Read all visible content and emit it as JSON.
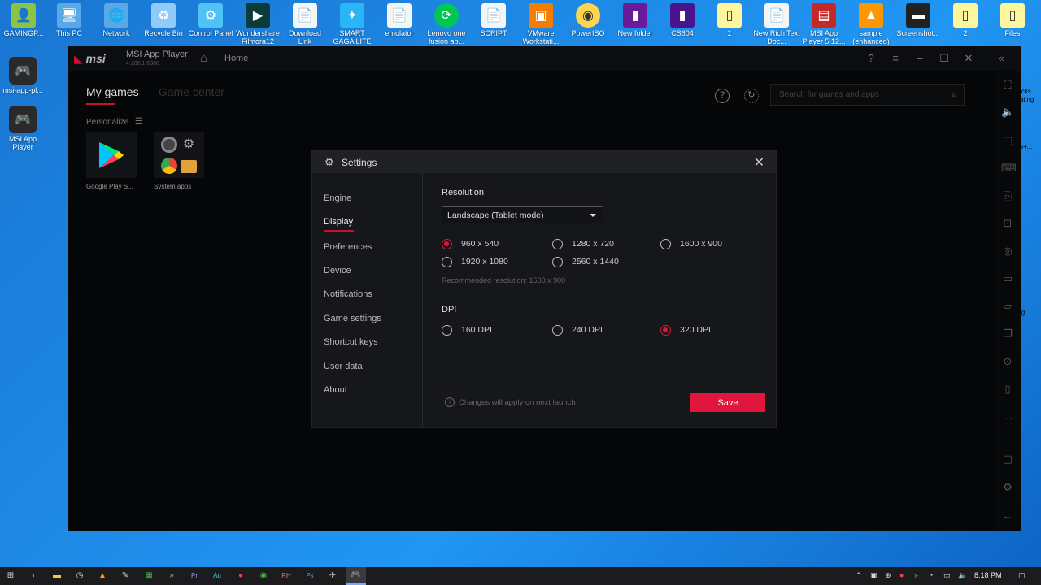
{
  "desktop": {
    "top_icons": [
      {
        "label": "GAMINGP...",
        "color": "#8bc34a"
      },
      {
        "label": "This PC",
        "color": "#5aa9e6"
      },
      {
        "label": "Network",
        "color": "#5aa9e6"
      },
      {
        "label": "Recycle Bin",
        "color": "#90caf9"
      },
      {
        "label": "Control Panel",
        "color": "#4fc3f7"
      },
      {
        "label": "Wondershare Filmora12",
        "color": "#0b3b3b"
      },
      {
        "label": "Download Link",
        "color": "#f5f5f5"
      },
      {
        "label": "SMART GAGA LITE",
        "color": "#29b6f6"
      },
      {
        "label": "emulator",
        "color": "#f5f5f5"
      },
      {
        "label": "Lenovo one fusion ap...",
        "color": "#00c853"
      },
      {
        "label": "SCRIPT",
        "color": "#f5f5f5"
      },
      {
        "label": "VMware Workstati...",
        "color": "#f57c00"
      },
      {
        "label": "PowerISO",
        "color": "#ffd54f"
      },
      {
        "label": "New folder",
        "color": "#6a1b9a"
      },
      {
        "label": "CS604",
        "color": "#4a148c"
      },
      {
        "label": "1",
        "color": "#fff59d"
      },
      {
        "label": "New Rich Text Doc...",
        "color": "#f5f5f5"
      },
      {
        "label": "MSI App Player 5.12...",
        "color": "#c62828"
      },
      {
        "label": "sample (enhanced)",
        "color": "#ff9800"
      },
      {
        "label": "Screenshot...",
        "color": "#212121"
      },
      {
        "label": "2",
        "color": "#fff59d"
      },
      {
        "label": "Files",
        "color": "#fff59d"
      }
    ],
    "left_icons": [
      {
        "label": "msi-app-pl..."
      },
      {
        "label": "MSI App Player"
      }
    ],
    "edge_labels": [
      "icks",
      "ating",
      "s+...",
      "lg"
    ]
  },
  "app": {
    "logo": "msi",
    "name": "MSI App Player",
    "version": "4.280.1.6308",
    "home_label": "Home",
    "tabs": {
      "active": "My games",
      "inactive": "Game center"
    },
    "search_placeholder": "Search for games and apps",
    "personalize": "Personalize",
    "apps": [
      {
        "label": "Google Play S..."
      },
      {
        "label": "System apps"
      }
    ]
  },
  "settings": {
    "title": "Settings",
    "nav": [
      "Engine",
      "Display",
      "Preferences",
      "Device",
      "Notifications",
      "Game settings",
      "Shortcut keys",
      "User data",
      "About"
    ],
    "active_nav": "Display",
    "resolution_title": "Resolution",
    "orientation_value": "Landscape (Tablet mode)",
    "resolutions": [
      "960 x 540",
      "1280 x 720",
      "1600 x 900",
      "1920 x 1080",
      "2560 x 1440"
    ],
    "selected_resolution": "960 x 540",
    "recommended": "Recommended resolution: 1600 x 900",
    "dpi_title": "DPI",
    "dpis": [
      "160 DPI",
      "240 DPI",
      "320 DPI"
    ],
    "selected_dpi": "320 DPI",
    "note": "Changes will apply on next launch",
    "save_label": "Save",
    "accent": "#e0163c"
  },
  "taskbar": {
    "time": "8:18 PM"
  }
}
